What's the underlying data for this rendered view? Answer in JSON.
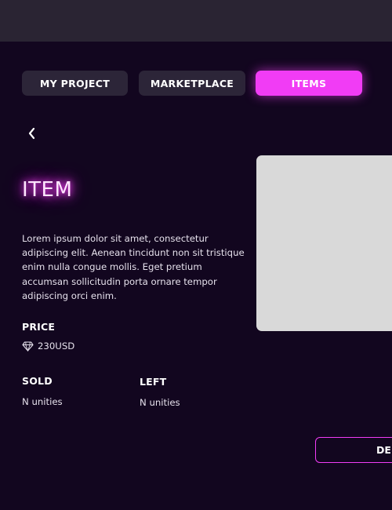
{
  "tabs": [
    {
      "label": "MY PROJECT",
      "active": false
    },
    {
      "label": "MARKETPLACE",
      "active": false
    },
    {
      "label": "ITEMS",
      "active": true
    }
  ],
  "item": {
    "title": "ITEM",
    "description": "Lorem ipsum dolor sit amet, consectetur adipiscing elit. Aenean tincidunt non sit tristique enim nulla congue mollis. Eget pretium accumsan sollicitudin porta ornare tempor adipiscing orci enim.",
    "price_label": "PRICE",
    "price_icon": "diamond-icon",
    "price_value": "230USD",
    "sold_label": "SOLD",
    "sold_value": "N unities",
    "left_label": "LEFT",
    "left_value": "N unities"
  },
  "action_button": {
    "label": "DE"
  },
  "colors": {
    "background": "#12061f",
    "topbar": "#2a2433",
    "accent": "#f13cf5",
    "tab_inactive": "#2c2538",
    "image_placeholder": "#d9d9d9"
  },
  "icons": {
    "back": "chevron-left-icon"
  }
}
